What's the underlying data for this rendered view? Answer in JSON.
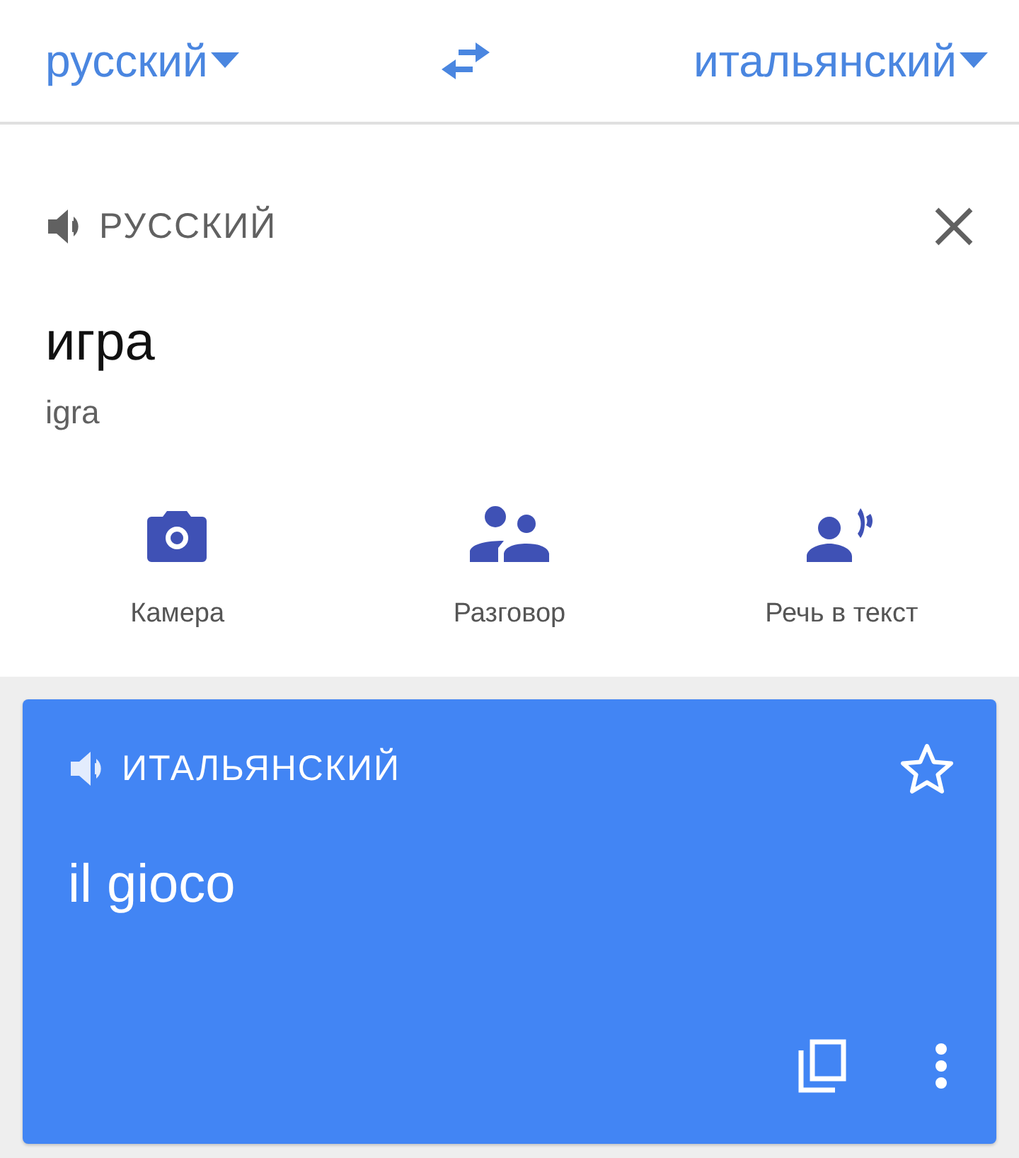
{
  "language_bar": {
    "source_language": "русский",
    "target_language": "итальянский"
  },
  "source": {
    "language_label": "РУССКИЙ",
    "text": "игра",
    "transliteration": "igra",
    "actions": [
      {
        "kind": "camera",
        "label": "Камера"
      },
      {
        "kind": "conversation",
        "label": "Разговор"
      },
      {
        "kind": "voice",
        "label": "Речь в текст"
      }
    ]
  },
  "result": {
    "language_label": "ИТАЛЬЯНСКИЙ",
    "text": "il gioco",
    "starred": false
  }
}
